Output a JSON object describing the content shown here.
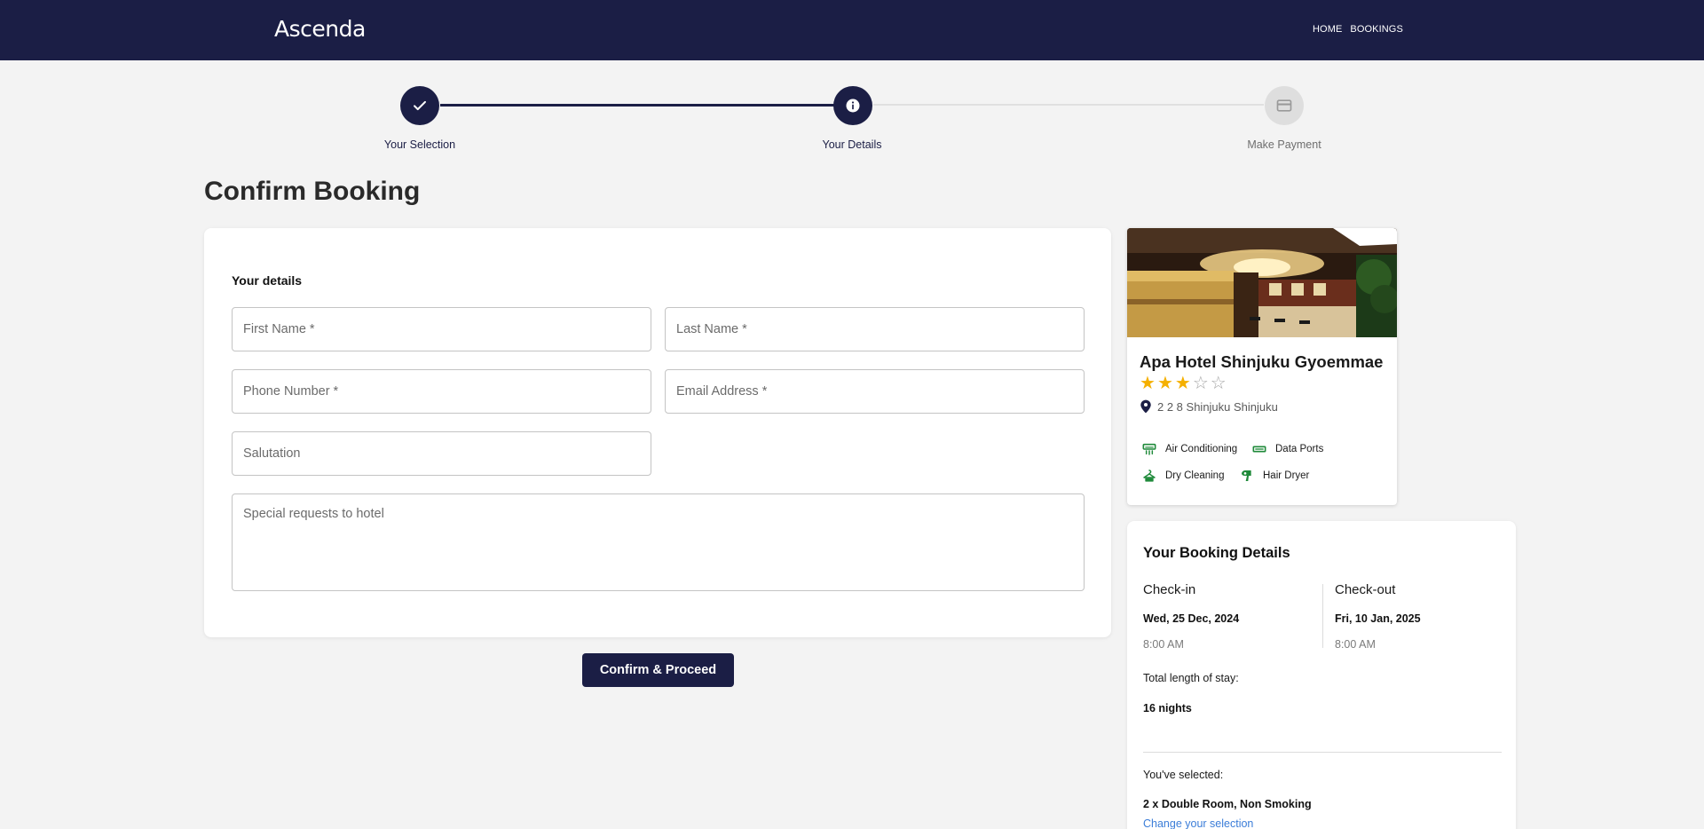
{
  "header": {
    "logo": "Ascenda",
    "nav": [
      "HOME",
      "BOOKINGS"
    ]
  },
  "stepper": {
    "steps": [
      {
        "label": "Your Selection",
        "state": "completed",
        "icon": "check-icon"
      },
      {
        "label": "Your Details",
        "state": "current",
        "icon": "info-icon"
      },
      {
        "label": "Make Payment",
        "state": "pending",
        "icon": "card-icon"
      }
    ]
  },
  "page": {
    "title": "Confirm Booking"
  },
  "form": {
    "section_title": "Your details",
    "first_name_placeholder": "First Name *",
    "last_name_placeholder": "Last Name *",
    "phone_placeholder": "Phone Number *",
    "email_placeholder": "Email Address *",
    "salutation_placeholder": "Salutation",
    "requests_placeholder": "Special requests to hotel",
    "confirm_label": "Confirm & Proceed"
  },
  "hotel": {
    "name": "Apa Hotel Shinjuku Gyoemmae",
    "rating": 3,
    "rating_max": 5,
    "address": "2 2 8 Shinjuku Shinjuku",
    "amenities": [
      {
        "label": "Air Conditioning",
        "icon": "air-conditioning-icon"
      },
      {
        "label": "Data Ports",
        "icon": "data-ports-icon"
      },
      {
        "label": "Dry Cleaning",
        "icon": "dry-cleaning-icon"
      },
      {
        "label": "Hair Dryer",
        "icon": "hair-dryer-icon"
      }
    ]
  },
  "booking": {
    "title": "Your Booking Details",
    "checkin_label": "Check-in",
    "checkin_date": "Wed, 25 Dec, 2024",
    "checkin_time": "8:00 AM",
    "checkout_label": "Check-out",
    "checkout_date": "Fri, 10 Jan, 2025",
    "checkout_time": "8:00 AM",
    "stay_label": "Total length of stay:",
    "stay_value": "16 nights",
    "selected_label": "You've selected:",
    "selected_value": "2 x Double Room, Non Smoking",
    "change_link": "Change your selection"
  },
  "colors": {
    "brand": "#1b1e45",
    "page_bg": "#f3f3f3",
    "star": "#f5b000",
    "amenity": "#1f8a3a",
    "link": "#3b7dd8"
  }
}
